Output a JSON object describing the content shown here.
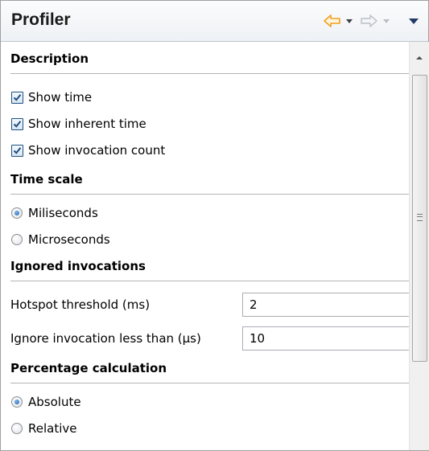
{
  "panel": {
    "title": "Profiler",
    "icons": [
      "back-arrow-icon",
      "chevron-down-icon",
      "forward-arrow-icon",
      "view-menu-icon"
    ]
  },
  "description": {
    "title": "Description",
    "options": [
      {
        "label": "Show time",
        "checked": true
      },
      {
        "label": "Show inherent time",
        "checked": true
      },
      {
        "label": "Show invocation count",
        "checked": true
      }
    ]
  },
  "time_scale": {
    "title": "Time scale",
    "options": [
      {
        "label": "Miliseconds",
        "selected": true
      },
      {
        "label": "Microseconds",
        "selected": false
      }
    ]
  },
  "ignored": {
    "title": "Ignored invocations",
    "fields": [
      {
        "label": "Hotspot threshold (ms)",
        "value": "2"
      },
      {
        "label": "Ignore invocation less than (µs)",
        "value": "10"
      }
    ]
  },
  "percentage": {
    "title": "Percentage calculation",
    "options": [
      {
        "label": "Absolute",
        "selected": true
      },
      {
        "label": "Relative",
        "selected": false
      }
    ]
  },
  "colors": {
    "back_arrow": "#f0a020",
    "forward_arrow_disabled": "#b9bfc7",
    "check_mark": "#1e4f80"
  }
}
